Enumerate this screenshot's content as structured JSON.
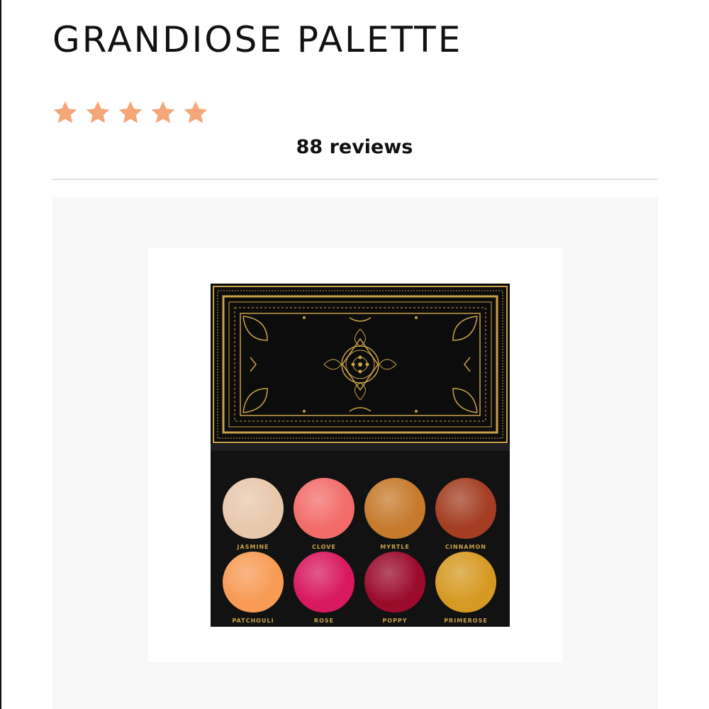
{
  "product": {
    "title": "GRANDIOSE PALETTE",
    "rating": {
      "value": 5,
      "max": 5
    },
    "reviews_label": "88 reviews"
  },
  "colors": {
    "star": "#f5a77a",
    "divider": "#e2e2e2",
    "gold": "#c9a14a"
  },
  "palette": {
    "shades": [
      {
        "name": "JASMINE",
        "color": "#e8c8ac"
      },
      {
        "name": "CLOVE",
        "color": "#f26d6a"
      },
      {
        "name": "MYRTLE",
        "color": "#c57a2c"
      },
      {
        "name": "CINNAMON",
        "color": "#a33e22"
      },
      {
        "name": "PATCHOULI",
        "color": "#f79b55"
      },
      {
        "name": "ROSE",
        "color": "#d8195f"
      },
      {
        "name": "POPPY",
        "color": "#9b0c2c"
      },
      {
        "name": "PRIMEROSE",
        "color": "#d59a23"
      }
    ]
  }
}
